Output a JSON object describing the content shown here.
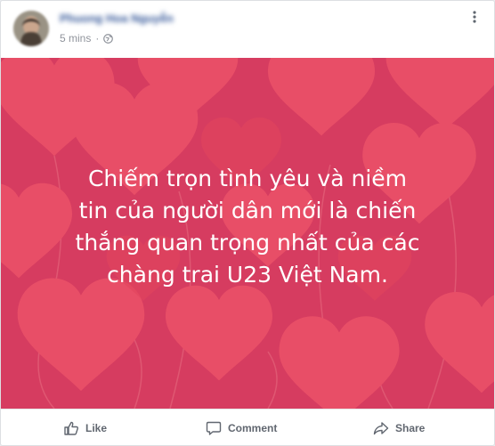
{
  "post": {
    "author_name": "Phuong Hoa Nguyễn",
    "timestamp": "5 mins",
    "separator": "·",
    "privacy_icon": "globe-icon",
    "menu_icon": "more-options-icon",
    "text": "Chiếm trọn tình yêu và niềm\ntin của người dân mới là chiến\nthắng quan trọng nhất của các\nchàng trai U23 Việt Nam.",
    "background": {
      "base_color": "#d93e62",
      "heart_color": "#f0546b",
      "motif": "heart-balloons"
    }
  },
  "actions": {
    "like": {
      "label": "Like",
      "icon": "like-icon"
    },
    "comment": {
      "label": "Comment",
      "icon": "comment-icon"
    },
    "share": {
      "label": "Share",
      "icon": "share-icon"
    }
  },
  "colors": {
    "text_on_image": "#ffffff",
    "action_text": "#616770",
    "meta_text": "#90949c"
  }
}
